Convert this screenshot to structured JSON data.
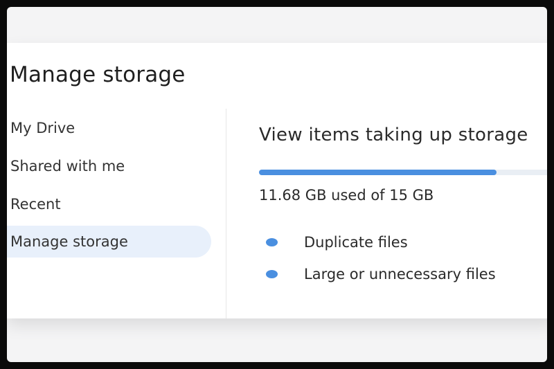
{
  "page": {
    "title": "Manage storage"
  },
  "sidebar": {
    "items": [
      {
        "label": "My Drive",
        "active": false
      },
      {
        "label": "Shared with me",
        "active": false
      },
      {
        "label": "Recent",
        "active": false
      },
      {
        "label": "Manage storage",
        "active": true
      }
    ]
  },
  "main": {
    "heading": "View items taking up storage",
    "storage": {
      "used_fraction": 0.78,
      "usage_text": "11.68 GB used of 15 GB"
    },
    "options": [
      {
        "label": "Duplicate files",
        "icon": "dot-icon"
      },
      {
        "label": "Large or unnecessary files",
        "icon": "dot-icon"
      }
    ]
  },
  "colors": {
    "accent": "#4a8fe0",
    "active_nav_bg": "#e8f0fb",
    "track": "#e9eef4"
  }
}
